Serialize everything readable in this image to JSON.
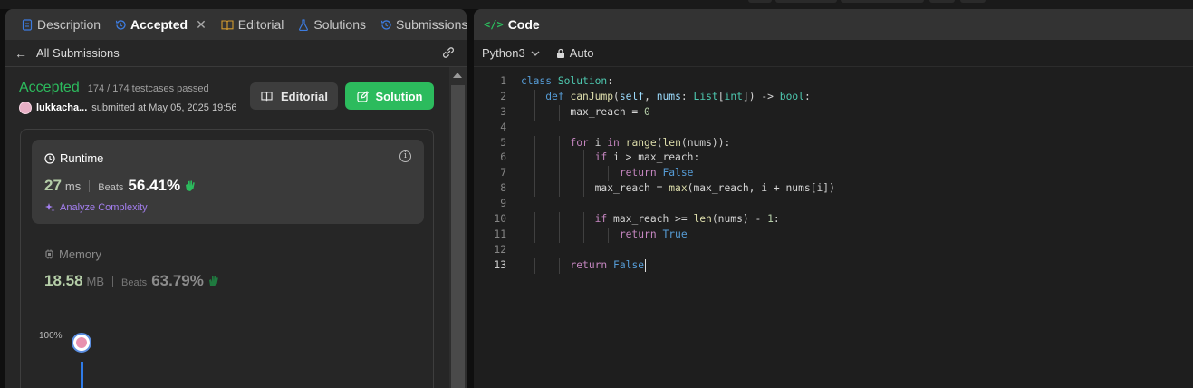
{
  "left_panel": {
    "tabs": [
      {
        "label": "Description",
        "icon": "document-icon"
      },
      {
        "label": "Accepted",
        "icon": "history-icon",
        "active": true,
        "closable": true
      },
      {
        "label": "Editorial",
        "icon": "book-icon"
      },
      {
        "label": "Solutions",
        "icon": "flask-icon"
      },
      {
        "label": "Submissions",
        "icon": "history-icon"
      }
    ],
    "back_label": "All Submissions",
    "status": "Accepted",
    "testcases": "174 / 174 testcases passed",
    "username": "lukkacha...",
    "submitted_text": "submitted at May 05, 2025 19:56",
    "editorial_button": "Editorial",
    "solution_button": "Solution",
    "runtime": {
      "label": "Runtime",
      "value": "27",
      "unit": "ms",
      "beats_label": "Beats",
      "beats_pct": "56.41%",
      "analyze_label": "Analyze Complexity"
    },
    "memory": {
      "label": "Memory",
      "value": "18.58",
      "unit": "MB",
      "beats_label": "Beats",
      "beats_pct": "63.79%"
    },
    "chart_axis_label": "100%"
  },
  "right_panel": {
    "title": "Code",
    "language": "Python3",
    "mode": "Auto",
    "current_line": 13,
    "code_lines": [
      "class Solution:",
      "    def canJump(self, nums: List[int]) -> bool:",
      "        max_reach = 0",
      "",
      "        for i in range(len(nums)):",
      "            if i > max_reach:",
      "                return False",
      "            max_reach = max(max_reach, i + nums[i])",
      "",
      "            if max_reach >= len(nums) - 1:",
      "                return True",
      "",
      "        return False"
    ]
  },
  "colors": {
    "accent_green": "#2cbb5d",
    "purple": "#a47ff0",
    "keyword_blue": "#569cd6"
  }
}
